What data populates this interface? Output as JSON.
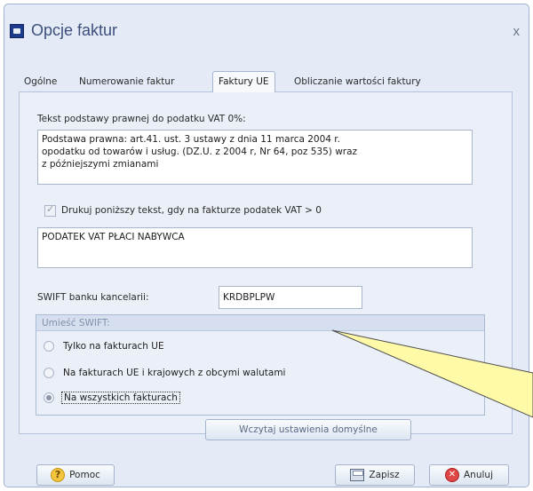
{
  "window": {
    "title": "Opcje faktur",
    "close_label": "x"
  },
  "tabs": [
    {
      "label": "Ogólne",
      "active": false
    },
    {
      "label": "Numerowanie faktur",
      "active": false
    },
    {
      "label": "Faktury UE",
      "active": true
    },
    {
      "label": "Obliczanie wartości faktury",
      "active": false
    }
  ],
  "legal_text": {
    "label": "Tekst podstawy prawnej do podatku VAT 0%:",
    "value_line1": "Podstawa prawna: art.41. ust. 3 ustawy z dnia 11 marca 2004 r.",
    "value_line2": "opodatku od towarów i usług. (DZ.U. z 2004 r, Nr 64, poz 535) wraz",
    "value_line3": "z późniejszymi zmianami"
  },
  "print_checkbox": {
    "label": "Drukuj poniższy tekst, gdy na fakturze podatek VAT > 0",
    "checked": true,
    "enabled": false
  },
  "vat_text": {
    "value": "PODATEK VAT PŁACI NABYWCA"
  },
  "swift": {
    "label": "SWIFT banku kancelarii:",
    "value": "KRDBPLPW"
  },
  "swift_placement": {
    "header": "Umieść SWIFT:",
    "options": [
      {
        "label": "Tylko na fakturach UE",
        "selected": false
      },
      {
        "label": "Na fakturach UE i krajowych z obcymi walutami",
        "selected": false
      },
      {
        "label": "Na wszystkich fakturach",
        "selected": true
      }
    ]
  },
  "buttons": {
    "defaults": "Wczytaj ustawienia domyślne",
    "help": "Pomoc",
    "save": "Zapisz",
    "cancel": "Anuluj"
  },
  "icons": {
    "app": "app-icon",
    "help": "question-icon",
    "save": "save-icon",
    "cancel": "cancel-icon"
  },
  "colors": {
    "window_bg": "#e4ebf6",
    "title": "#3d4f7a",
    "group_header": "#d5dff0",
    "callout_fill": "#fffaa8"
  }
}
